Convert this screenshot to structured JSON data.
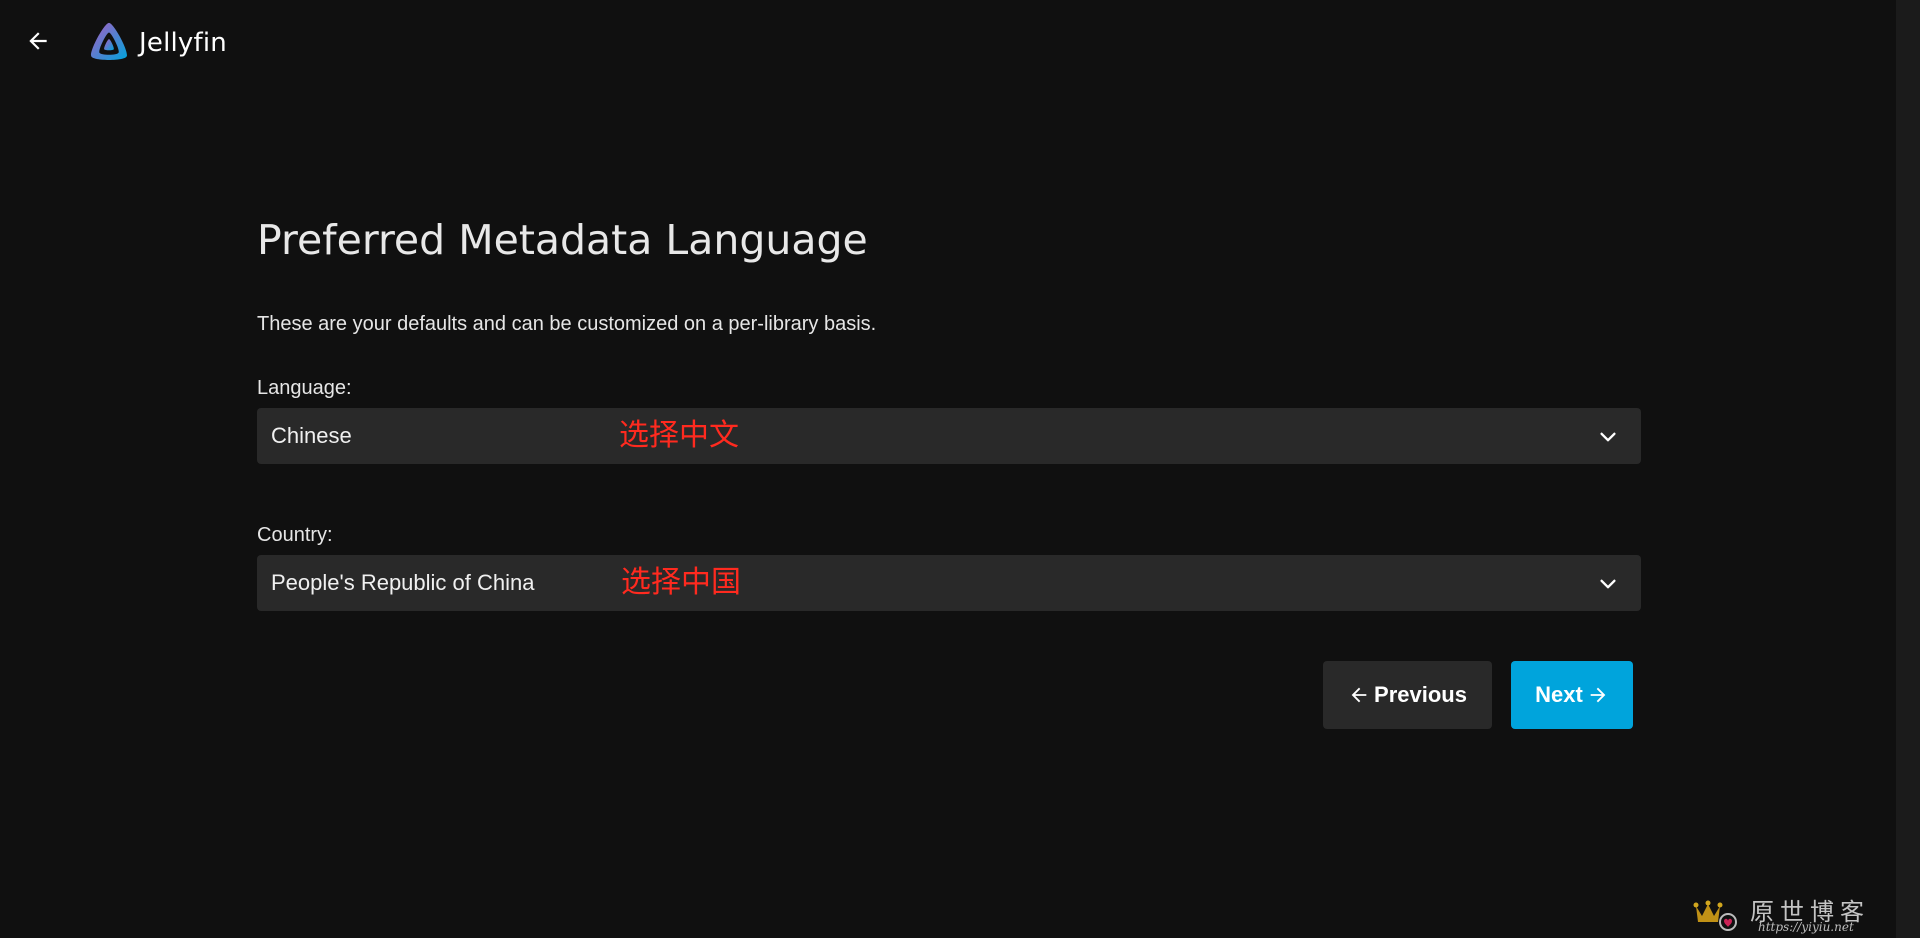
{
  "header": {
    "back_icon": "arrow-left-icon",
    "app_name": "Jellyfin",
    "logo_icon": "jellyfin-logo-icon",
    "logo_colors": [
      "#aa5cc3",
      "#00a4dc"
    ]
  },
  "main": {
    "title": "Preferred Metadata Language",
    "description": "These are your defaults and can be customized on a per-library basis.",
    "language": {
      "label": "Language:",
      "value": "Chinese",
      "annotation": "选择中文",
      "icon": "chevron-down-icon"
    },
    "country": {
      "label": "Country:",
      "value": "People's Republic of China",
      "annotation": "选择中国",
      "icon": "chevron-down-icon"
    }
  },
  "buttons": {
    "previous_label": "Previous",
    "next_label": "Next"
  },
  "watermark": {
    "text": "原世博客",
    "url": "https://yiyiu.net"
  },
  "colors": {
    "background": "#101010",
    "field_background": "#292929",
    "accent": "#00a4dc",
    "annotation": "#ff2a1f"
  }
}
